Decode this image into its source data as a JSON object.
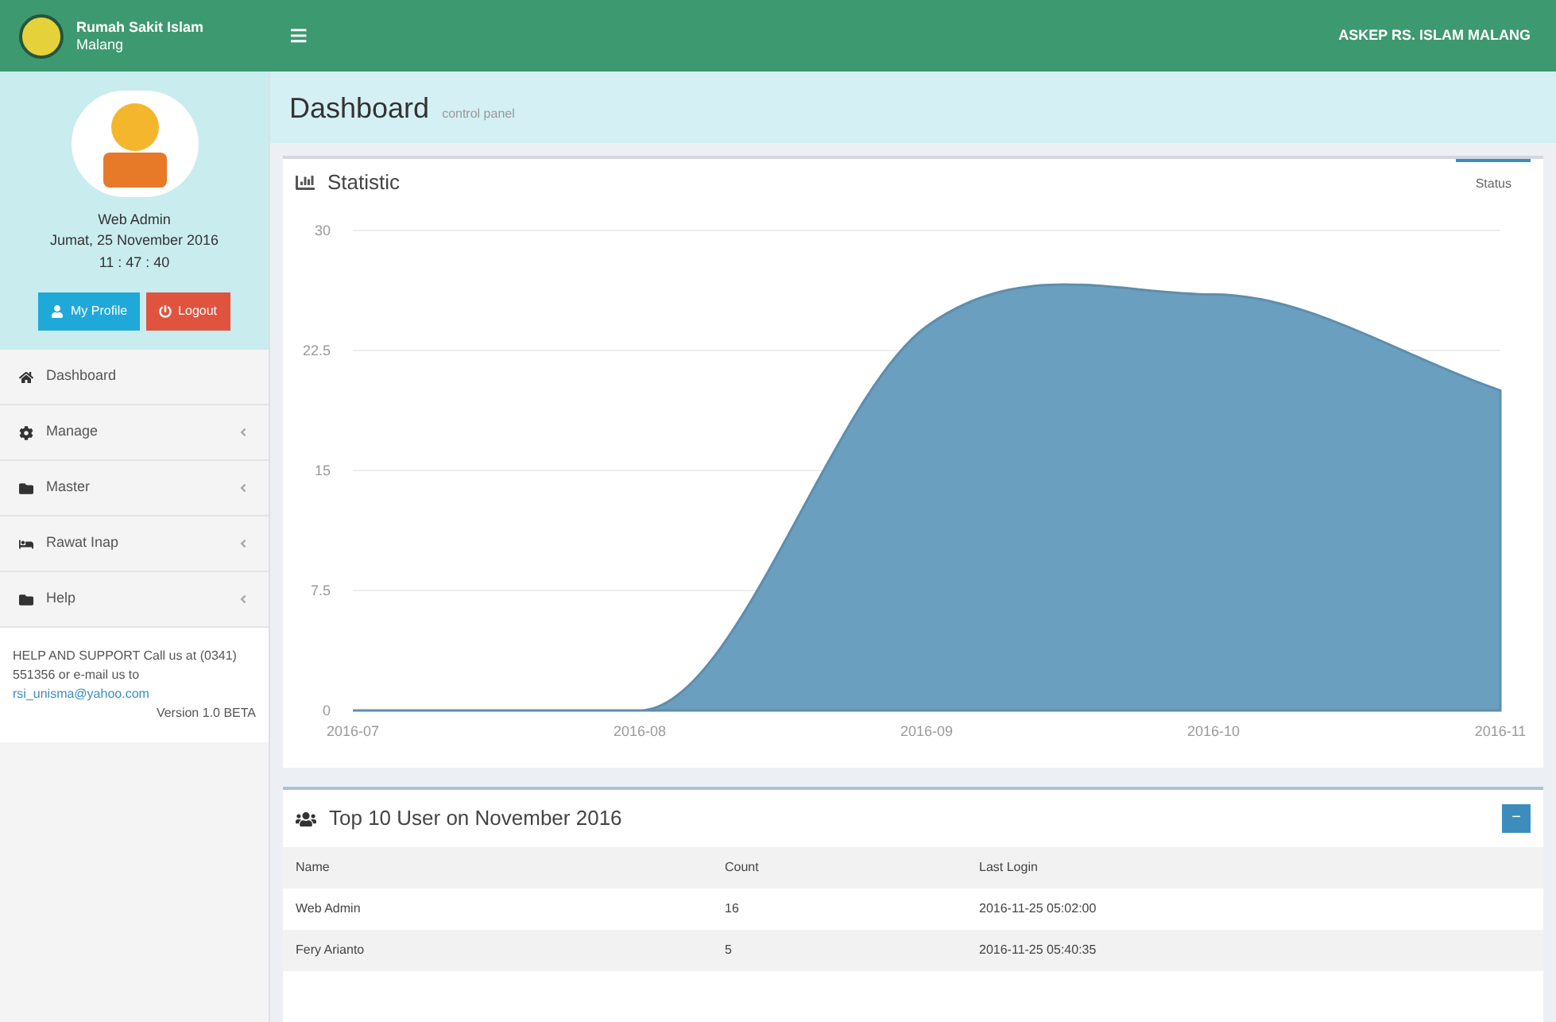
{
  "brand": {
    "line1": "Rumah Sakit Islam",
    "line2": "Malang"
  },
  "header": {
    "menu_glyph": "≡",
    "right_text": "ASKEP RS. ISLAM MALANG"
  },
  "user": {
    "name": "Web Admin",
    "date": "Jumat, 25 November 2016",
    "time": "11 : 47 : 40",
    "buttons": [
      {
        "label": "My Profile",
        "kind": "profile"
      },
      {
        "label": "Logout",
        "kind": "logout"
      }
    ]
  },
  "sidebar": {
    "items": [
      {
        "label": "Dashboard",
        "kind": "home",
        "expandable": false
      },
      {
        "label": "Manage",
        "kind": "settings",
        "expandable": true
      },
      {
        "label": "Master",
        "kind": "folder",
        "expandable": true
      },
      {
        "label": "Rawat Inap",
        "kind": "bed",
        "expandable": true
      },
      {
        "label": "Help",
        "kind": "folder",
        "expandable": true
      }
    ],
    "support": {
      "text": "HELP AND SUPPORT Call us at (0341) 551356 or e-mail us to",
      "email": "rsi_unisma@yahoo.com",
      "version": "Version 1.0 BETA"
    }
  },
  "page": {
    "title": "Dashboard",
    "subtitle": "control panel"
  },
  "statistic": {
    "title": "Statistic",
    "tab": "Status",
    "chart_data": {
      "type": "area",
      "categories": [
        "2016-07",
        "2016-08",
        "2016-09",
        "2016-10",
        "2016-11"
      ],
      "series": [
        {
          "color": "#6a9fc0",
          "values": [
            0,
            0,
            24,
            26,
            20
          ]
        }
      ],
      "ylim": [
        0,
        30
      ],
      "grid": true,
      "yticks": [
        0,
        7.5,
        15,
        22.5,
        30
      ]
    }
  },
  "top_users": {
    "title": "Top 10 User on November 2016",
    "collapse_glyph": "−",
    "columns": [
      "Name",
      "Count",
      "Last Login"
    ],
    "rows": [
      [
        "Web Admin",
        "16",
        "2016-11-25 05:02:00"
      ],
      [
        "Fery Arianto",
        "5",
        "2016-11-25 05:40:35"
      ]
    ]
  }
}
